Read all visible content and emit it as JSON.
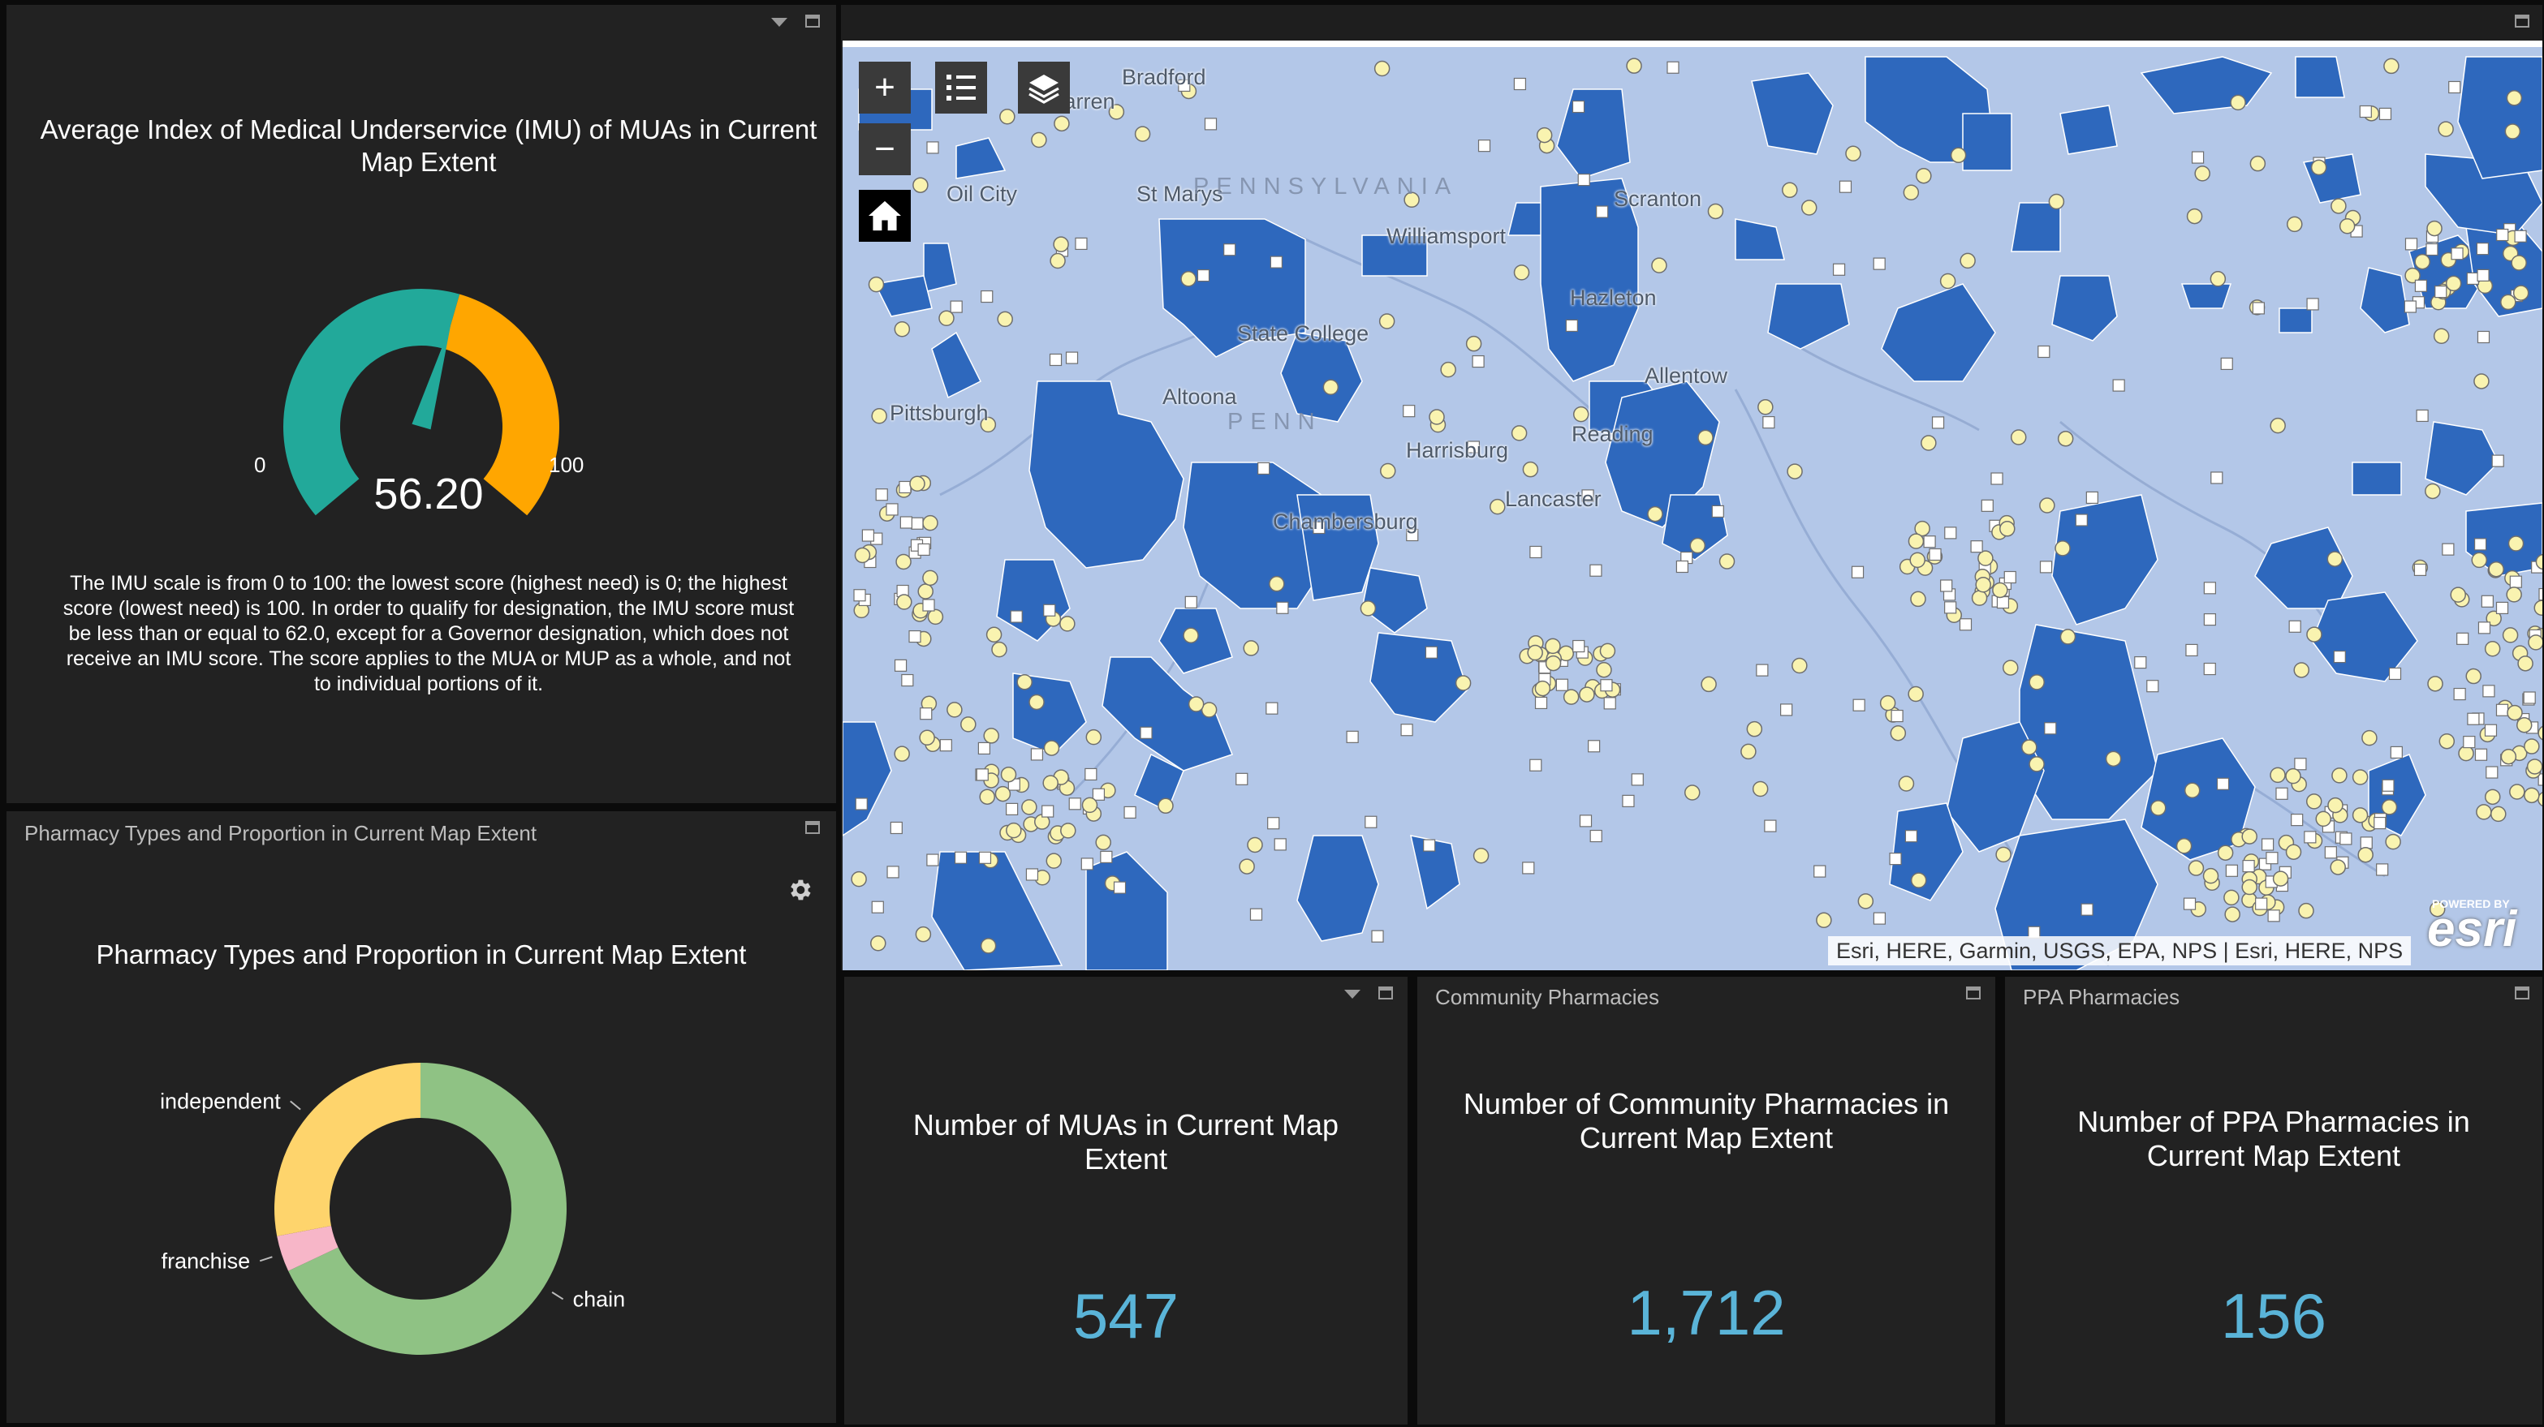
{
  "gauge_panel": {
    "title": "Average Index of Medical Underservice (IMU) of MUAs in Current Map Extent",
    "min_label": "0",
    "max_label": "100",
    "value_text": "56.20",
    "value": 56.2,
    "description": "The IMU scale is from 0 to 100: the lowest score (highest need) is 0; the highest score (lowest need) is 100. In order to qualify for designation, the IMU score must be less than or equal to 62.0, except for a Governor designation, which does not receive an IMU score. The score applies to the MUA or MUP as a whole, and not to individual portions of it.",
    "colors": {
      "low": "#22a99a",
      "high": "#ffa600"
    }
  },
  "pharmacy_panel": {
    "header": "Pharmacy Types and Proportion in Current Map Extent",
    "title": "Pharmacy Types and Proportion in Current Map Extent",
    "settings_icon": "gear-icon"
  },
  "chart_data": {
    "type": "pie",
    "categories": [
      "chain",
      "franchise",
      "independent"
    ],
    "values": [
      68,
      4,
      28
    ],
    "colors": [
      "#8fc284",
      "#f7b6c8",
      "#fed46c"
    ],
    "donut": true
  },
  "map": {
    "buttons": {
      "zoom_in": "+",
      "zoom_out": "−",
      "legend_icon": "legend-list-icon",
      "layers_icon": "layers-icon",
      "home_icon": "home-icon"
    },
    "places": {
      "bradford": "Bradford",
      "warren": "Warren",
      "oil_city": "Oil City",
      "st_marys": "St Marys",
      "pennsylvania": "PENNSYLVANIA",
      "scranton": "Scranton",
      "williamsport": "Williamsport",
      "hazleton": "Hazleton",
      "state_college": "State College",
      "allentown": "Allentow",
      "altoona": "Altoona",
      "pittsburgh": "Pittsburgh",
      "reading": "Reading",
      "harrisburg": "Harrisburg",
      "lancaster": "Lancaster",
      "chambersburg": "Chambersburg",
      "penn_fragment": "PENN"
    },
    "attribution": "Esri, HERE, Garmin, USGS, EPA, NPS | Esri, HERE, NPS",
    "powered_by": "POWERED BY",
    "esri_logo": "esri",
    "colors": {
      "water": "#b3c7e8",
      "mua": "#2e68bd",
      "pharmacy": "#f9f3b0"
    }
  },
  "mua_panel": {
    "title": "Number of MUAs in Current Map Extent",
    "value": "547"
  },
  "community_panel": {
    "header": "Community Pharmacies",
    "title": "Number of Community Pharmacies in Current Map Extent",
    "value": "1,712"
  },
  "ppa_panel": {
    "header": "PPA Pharmacies",
    "title": "Number of PPA Pharmacies in Current Map Extent",
    "value": "156"
  }
}
